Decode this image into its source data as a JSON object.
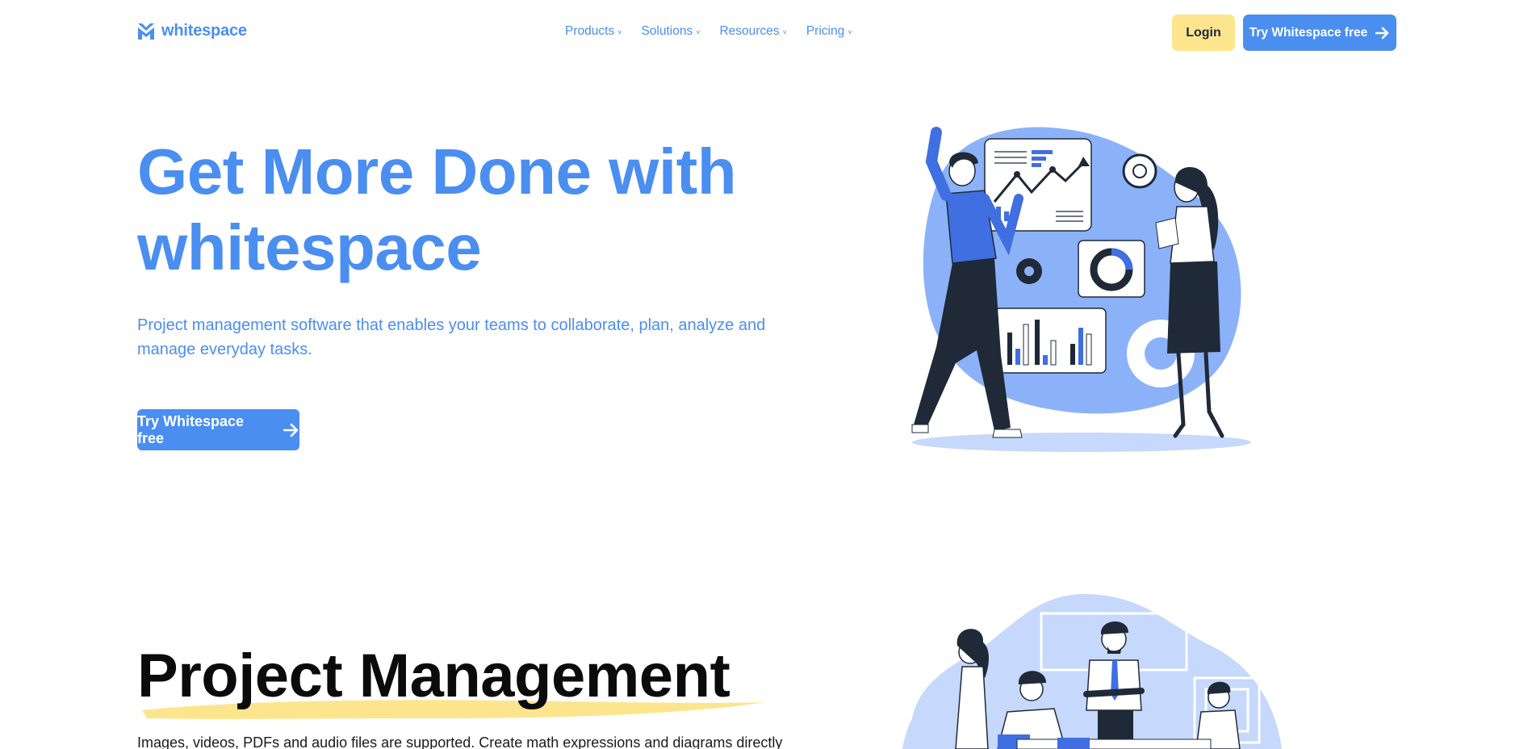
{
  "brand": {
    "name": "whitespace",
    "color": "#4a8ef0",
    "icon": "whitespace-logo-icon"
  },
  "nav": {
    "items": [
      {
        "label": "Products",
        "icon": "chevron-down-icon"
      },
      {
        "label": "Solutions",
        "icon": "chevron-down-icon"
      },
      {
        "label": "Resources",
        "icon": "chevron-down-icon"
      },
      {
        "label": "Pricing",
        "icon": "chevron-down-icon"
      }
    ],
    "login_label": "Login",
    "login_color": "#fde58e",
    "try_label": "Try Whitespace free",
    "try_icon": "arrow-right-icon"
  },
  "hero": {
    "title": "Get More Done with whitespace",
    "subtitle": "Project management software that enables your teams to collaborate, plan, analyze and manage everyday tasks.",
    "cta_label": "Try Whitespace free",
    "cta_icon": "arrow-right-icon",
    "illustration": "team-analytics-illustration"
  },
  "section_pm": {
    "title": "Project Management",
    "underline_color": "#fde58e",
    "description": "Images, videos, PDFs and audio files are supported. Create math expressions and diagrams directly",
    "illustration": "team-meeting-illustration"
  }
}
